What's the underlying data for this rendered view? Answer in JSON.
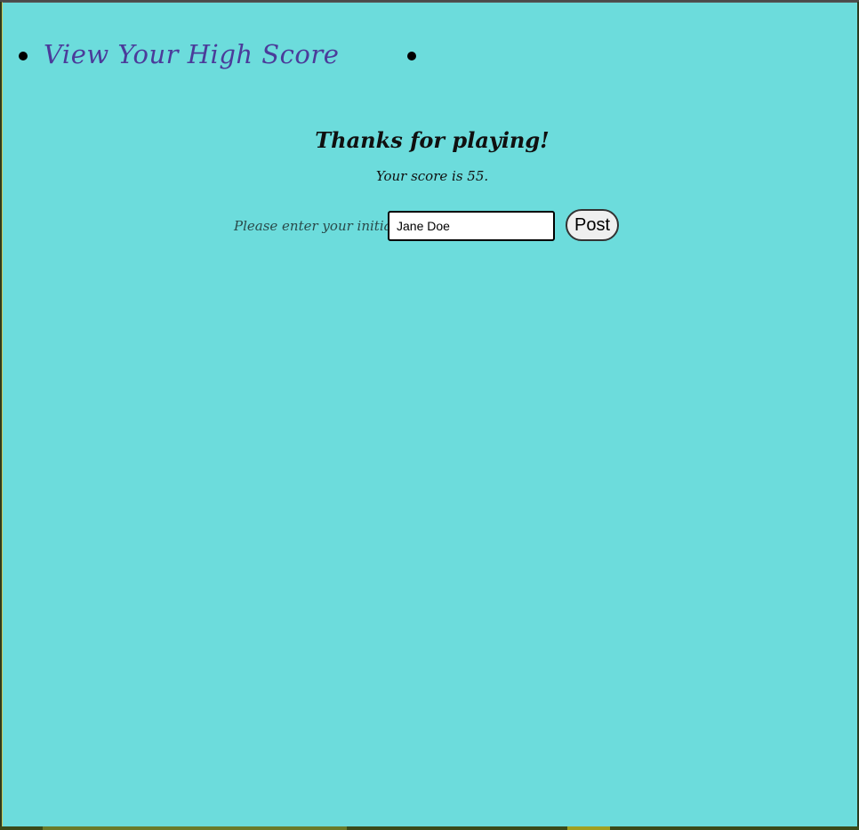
{
  "nav": {
    "items": [
      {
        "label": "View Your High Score"
      },
      {
        "label": ""
      }
    ]
  },
  "main": {
    "heading": "Thanks for playing!",
    "score_text": "Your score is 55.",
    "form": {
      "initials_label": "Please enter your initials:",
      "initials_value": "Jane Doe",
      "post_label": "Post"
    }
  },
  "colors": {
    "background": "#6cdcdc",
    "link": "#4b3b9a"
  }
}
